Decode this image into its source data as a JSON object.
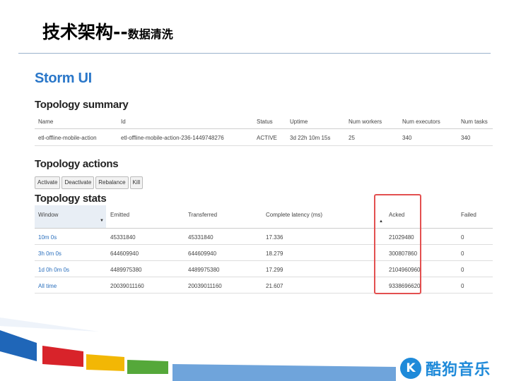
{
  "slide": {
    "title_main": "技术架构--",
    "title_sub": "数据清洗"
  },
  "app_title": "Storm UI",
  "summary": {
    "heading": "Topology summary",
    "columns": [
      "Name",
      "Id",
      "Status",
      "Uptime",
      "Num workers",
      "Num executors",
      "Num tasks"
    ],
    "row": [
      "etl-offline-mobile-action",
      "etl-offline-mobile-action-236-1449748276",
      "ACTIVE",
      "3d 22h 10m 15s",
      "25",
      "340",
      "340"
    ]
  },
  "actions": {
    "heading": "Topology actions",
    "buttons": [
      "Activate",
      "Deactivate",
      "Rebalance",
      "Kill"
    ]
  },
  "stats": {
    "heading": "Topology stats",
    "columns": [
      "Window",
      "Emitted",
      "Transferred",
      "Complete latency (ms)",
      "Acked",
      "Failed"
    ],
    "rows": [
      [
        "10m 0s",
        "45331840",
        "45331840",
        "17.336",
        "21029480",
        "0"
      ],
      [
        "3h 0m 0s",
        "644609940",
        "644609940",
        "18.279",
        "300807860",
        "0"
      ],
      [
        "1d 0h 0m 0s",
        "4489975380",
        "4489975380",
        "17.299",
        "2104960960",
        "0"
      ],
      [
        "All time",
        "20039011160",
        "20039011160",
        "21.607",
        "9338696620",
        "0"
      ]
    ]
  },
  "logo": {
    "text": "酷狗音乐",
    "mark": "K"
  },
  "colors": {
    "accent": "#2a77c9",
    "highlight": "#e35050",
    "logo": "#1f8ad9"
  }
}
